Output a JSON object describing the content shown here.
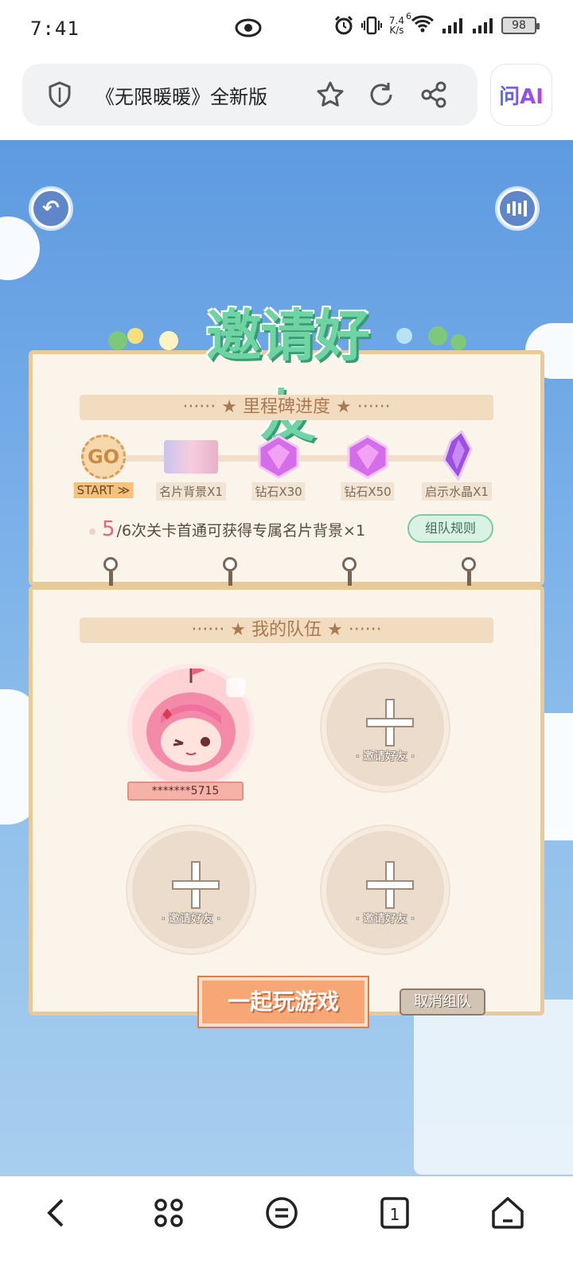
{
  "status_bar": {
    "time": "7:41",
    "net_speed_top": "7.4",
    "net_speed_bottom": "K/s",
    "wifi_badge": "6",
    "battery": "98"
  },
  "browser": {
    "page_title": "《无限暖暖》全新版",
    "ai_button_label": "问AI"
  },
  "game": {
    "headline": "邀请好友",
    "milestone_header": "······ ★ 里程碑进度 ★ ······",
    "milestones": [
      {
        "icon": "go-badge-icon",
        "node_text": "GO",
        "label": "START ≫"
      },
      {
        "icon": "name-card-background-icon",
        "label": "名片背景X1"
      },
      {
        "icon": "diamond-icon",
        "label": "钻石X30"
      },
      {
        "icon": "diamond-icon",
        "label": "钻石X50"
      },
      {
        "icon": "crystal-icon",
        "label": "启示水晶X1"
      }
    ],
    "progress_current": "5",
    "progress_text": "/6次关卡首通可获得专属名片背景×1",
    "rules_button": "组队规则",
    "team_header": "······ ★ 我的队伍 ★ ······",
    "member_id": "*******5715",
    "invite_label": "· 邀请好友 ·",
    "play_button": "一起玩游戏",
    "cancel_button": "取消组队"
  },
  "colors": {
    "sky": "#79b0ea",
    "panel": "#fbf4ea",
    "headline_green": "#6fd4a4",
    "play_orange": "#f7a775",
    "accent_pink": "#e8647d"
  }
}
